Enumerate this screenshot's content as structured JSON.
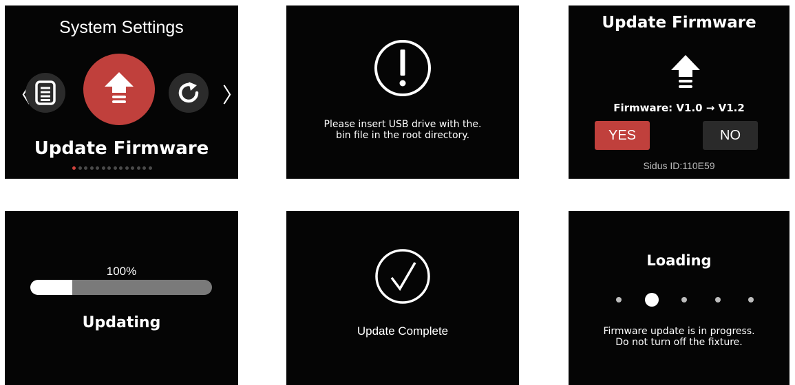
{
  "screen1": {
    "title": "System Settings",
    "selected_label": "Update Firmware",
    "left_icon": "document-icon",
    "center_icon": "upload-arrow-icon",
    "right_icon": "refresh-icon",
    "prev_glyph": "〈",
    "next_glyph": "〉",
    "page_count": 14,
    "active_page": 0
  },
  "screen2": {
    "icon": "exclamation-circle-icon",
    "message_line1": "Please insert USB drive with the.",
    "message_line2": "bin file in the root directory."
  },
  "screen3": {
    "title": "Update Firmware",
    "icon": "upload-arrow-icon",
    "firmware_text": "Firmware: V1.0 → V1.2",
    "yes_label": "YES",
    "no_label": "NO",
    "sidus_id": "Sidus ID:110E59"
  },
  "screen4": {
    "percent_label": "100%",
    "progress_fraction": 0.23,
    "status": "Updating"
  },
  "screen5": {
    "icon": "checkmark-circle-icon",
    "message": "Update Complete"
  },
  "screen6": {
    "title": "Loading",
    "active_dot": 1,
    "dot_count": 5,
    "message_line1": "Firmware update is in progress.",
    "message_line2": "Do not turn off the fixture."
  },
  "colors": {
    "accent_red": "#c0403c",
    "screen_bg": "#050505",
    "button_dark": "#2a2a2a"
  }
}
